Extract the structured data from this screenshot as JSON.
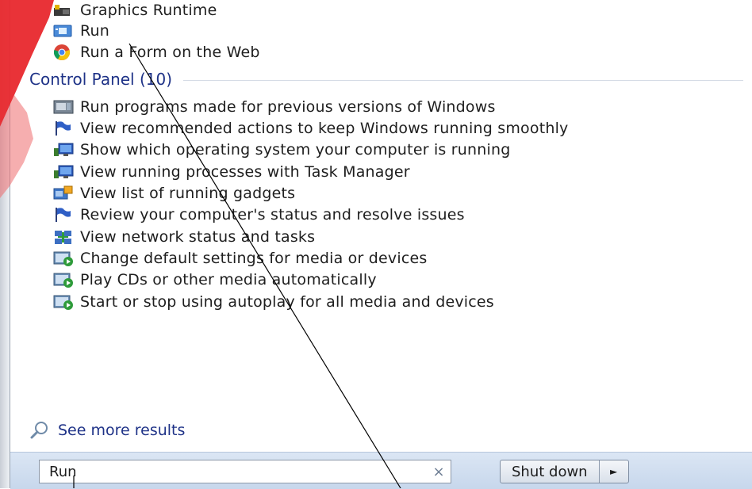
{
  "programs": [
    {
      "label": "Graphics Runtime",
      "icon": "graphics-runtime-icon"
    },
    {
      "label": "Run",
      "icon": "run-icon"
    },
    {
      "label": "Run a Form on the Web",
      "icon": "chrome-icon"
    }
  ],
  "control_panel": {
    "heading": "Control Panel (10)",
    "items": [
      {
        "label": "Run programs made for previous versions of Windows",
        "icon": "compatibility-icon"
      },
      {
        "label": "View recommended actions to keep Windows running smoothly",
        "icon": "action-center-flag-icon"
      },
      {
        "label": "Show which operating system your computer is running",
        "icon": "system-icon"
      },
      {
        "label": "View running processes with Task Manager",
        "icon": "system-icon"
      },
      {
        "label": "View list of running gadgets",
        "icon": "gadgets-icon"
      },
      {
        "label": "Review your computer's status and resolve issues",
        "icon": "action-center-flag-icon"
      },
      {
        "label": "View network status and tasks",
        "icon": "network-icon"
      },
      {
        "label": "Change default settings for media or devices",
        "icon": "autoplay-icon"
      },
      {
        "label": "Play CDs or other media automatically",
        "icon": "autoplay-icon"
      },
      {
        "label": "Start or stop using autoplay for all media and devices",
        "icon": "autoplay-icon"
      }
    ]
  },
  "see_more": "See more results",
  "search": {
    "value": "Run",
    "clear_glyph": "×"
  },
  "shutdown": {
    "label": "Shut down",
    "arrow_glyph": "►"
  },
  "colors": {
    "link_blue": "#1e3287",
    "annotation_red": "#e8282d"
  }
}
